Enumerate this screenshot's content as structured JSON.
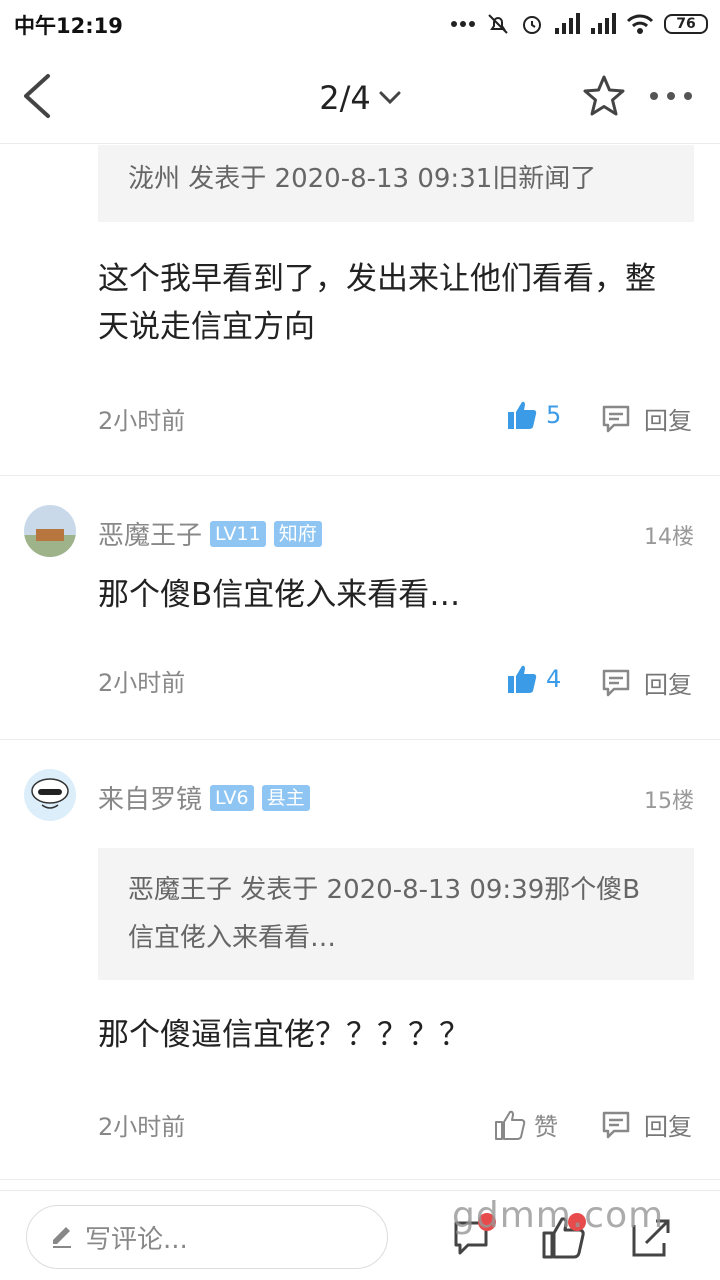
{
  "status_bar": {
    "time": "中午12:19",
    "battery": "76"
  },
  "nav": {
    "page_indicator": "2/4"
  },
  "comments": [
    {
      "quote": "泷州 发表于 2020-8-13 09:31旧新闻了",
      "text": "这个我早看到了，发出来让他们看看，整天说走信宜方向",
      "time": "2小时前",
      "likes": "5",
      "reply_label": "回复"
    },
    {
      "user": "恶魔王子",
      "level": "LV11",
      "title": "知府",
      "floor": "14楼",
      "text": "那个傻B信宜佬入来看看…",
      "time": "2小时前",
      "likes": "4",
      "reply_label": "回复"
    },
    {
      "user": "来自罗镜",
      "level": "LV6",
      "title": "县主",
      "floor": "15楼",
      "quote": "恶魔王子 发表于 2020-8-13 09:39那个傻B信宜佬入来看看…",
      "text": "那个傻逼信宜佬？？？？？",
      "time": "2小时前",
      "likes": "赞",
      "reply_label": "回复"
    }
  ],
  "bottom_bar": {
    "placeholder": "写评论...",
    "watermark": "gdmm.com"
  },
  "colors": {
    "accent": "#3b9be6",
    "badge": "#8ec5f2",
    "quote_bg": "#f4f4f4"
  },
  "icons": [
    "back-icon",
    "chevron-down-icon",
    "star-icon",
    "more-icon",
    "thumbs-up-icon",
    "reply-bubble-icon",
    "pencil-icon",
    "comments-icon",
    "like-icon",
    "share-icon"
  ]
}
